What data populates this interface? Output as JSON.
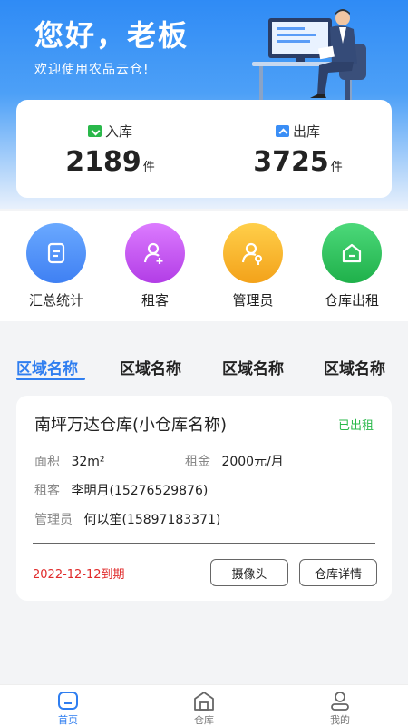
{
  "header": {
    "greeting": "您好，老板",
    "subtitle": "欢迎使用农品云仓!"
  },
  "stats": {
    "inbound": {
      "label": "入库",
      "value": "2189",
      "unit": "件",
      "icon": "inbound-box-icon",
      "color": "#29b84a"
    },
    "outbound": {
      "label": "出库",
      "value": "3725",
      "unit": "件",
      "icon": "outbound-box-icon",
      "color": "#3a8ef6"
    }
  },
  "quick_actions": [
    {
      "label": "汇总统计",
      "icon": "document-icon",
      "color": "#4b8ff7"
    },
    {
      "label": "租客",
      "icon": "add-user-icon",
      "color": "#c254f0"
    },
    {
      "label": "管理员",
      "icon": "admin-user-icon",
      "color": "#f7b52a"
    },
    {
      "label": "仓库出租",
      "icon": "warehouse-home-icon",
      "color": "#27c35a"
    }
  ],
  "tabs": [
    {
      "label": "区域名称",
      "active": true
    },
    {
      "label": "区域名称",
      "active": false
    },
    {
      "label": "区域名称",
      "active": false
    },
    {
      "label": "区域名称",
      "active": false
    }
  ],
  "warehouse": {
    "name": "南坪万达仓库(小仓库名称)",
    "status": "已出租",
    "area_label": "面积",
    "area_value": "32m²",
    "rent_label": "租金",
    "rent_value": "2000元/月",
    "tenant_label": "租客",
    "tenant_value": "李明月(15276529876)",
    "admin_label": "管理员",
    "admin_value": "何以笙(15897183371)",
    "expire": "2022-12-12到期",
    "camera_button": "摄像头",
    "detail_button": "仓库详情"
  },
  "nav": [
    {
      "label": "首页",
      "icon": "home-icon",
      "active": true
    },
    {
      "label": "仓库",
      "icon": "warehouse-icon",
      "active": false
    },
    {
      "label": "我的",
      "icon": "profile-icon",
      "active": false
    }
  ],
  "colors": {
    "primary": "#2f7ef0",
    "status_green": "#29b84a",
    "expire_red": "#e02b2b"
  }
}
